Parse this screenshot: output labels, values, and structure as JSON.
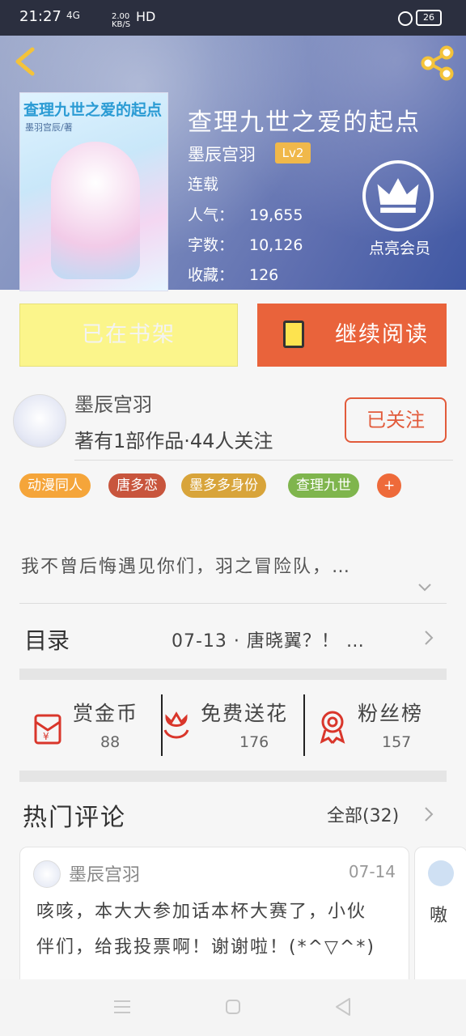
{
  "status_bar": {
    "time": "21:27",
    "network": "4G",
    "speed": "2.00",
    "speed_unit": "KB/S",
    "hd": "HD",
    "battery": "26"
  },
  "book": {
    "title": "查理九世之爱的起点",
    "author": "墨辰宫羽",
    "level": "Lv2",
    "status": "连载",
    "popularity_label": "人气：",
    "popularity": "19,655",
    "words_label": "字数：",
    "words": "10,126",
    "favorites_label": "收藏：",
    "favorites": "126",
    "cover_title": "查理九世之爱的起点",
    "cover_author": "墨羽宫辰/著"
  },
  "vip": {
    "label": "点亮会员"
  },
  "actions": {
    "shelf_label": "已在书架",
    "read_label": "继续阅读"
  },
  "author_card": {
    "name": "墨辰宫羽",
    "works": "著有1部作品·44人关注",
    "follow_label": "已关注"
  },
  "tags": [
    {
      "label": "动漫同人",
      "color": "#f5a53a"
    },
    {
      "label": "唐多恋",
      "color": "#c8553d"
    },
    {
      "label": "墨多多身份",
      "color": "#d8a43a"
    },
    {
      "label": "查理九世",
      "color": "#7fb54d"
    },
    {
      "label": "+",
      "color": "#ee6a3a"
    }
  ],
  "intro": {
    "text": "我不曾后悔遇见你们，羽之冒险队，…"
  },
  "toc": {
    "label": "目录",
    "latest": "07-13 · 唐晓翼？！ …"
  },
  "stats": [
    {
      "label": "赏金币",
      "value": "88",
      "icon": "red-envelope-icon"
    },
    {
      "label": "免费送花",
      "value": "176",
      "icon": "flower-icon"
    },
    {
      "label": "粉丝榜",
      "value": "157",
      "icon": "medal-icon"
    }
  ],
  "comments": {
    "title": "热门评论",
    "all_label": "全部(32)",
    "items": [
      {
        "user": "墨辰宫羽",
        "date": "07-14",
        "text": "咳咳，本大大参加话本杯大赛了，小伙伴们，给我投票啊！谢谢啦！(*^▽^*)"
      },
      {
        "user": "",
        "date": "",
        "text": "嗷"
      }
    ]
  },
  "colors": {
    "accent": "#e9633b",
    "shelf_bg": "#fbf58b",
    "follow": "#e25b3b"
  }
}
